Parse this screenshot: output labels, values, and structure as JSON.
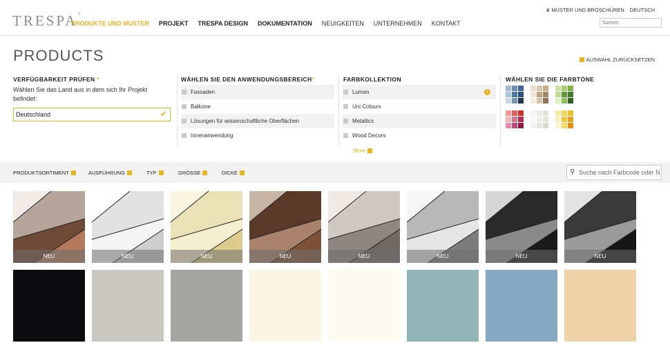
{
  "header": {
    "logo": "TRESPA",
    "nav": [
      "PRODUKTE UND MUSTER",
      "PROJEKT",
      "TRESPA DESIGN",
      "DOKUMENTATION",
      "NEUIGKEITEN",
      "UNTERNEHMEN",
      "KONTAKT"
    ],
    "utility": {
      "samples": "MUSTER UND BROSCHÜREN",
      "language": "DEUTSCH"
    },
    "search_placeholder": "Suchen"
  },
  "page": {
    "title": "PRODUCTS",
    "reset": "AUSWAHL ZURÜCKSETZEN"
  },
  "filters": {
    "availability": {
      "heading": "VERFÜGBARKEIT PRÜFEN",
      "required_mark": "*",
      "description": "Wählen Sie das Land aus in dem sich Ihr Projekt befindet:",
      "country": "Deutschland"
    },
    "application": {
      "heading": "WÄHLEN SIE DEN ANWENDUNGSBEREICH",
      "required_mark": "*",
      "options": [
        "Fassaden",
        "Balkone",
        "Lösungen für wissenschaftliche Oberflächen",
        "Innenanwendung"
      ]
    },
    "collection": {
      "heading": "FARBKOLLEKTION",
      "options": [
        "Lumen",
        "Uni Colours",
        "Metallics",
        "Wood Decors"
      ],
      "more": "More"
    },
    "tones": {
      "heading": "WÄHLEN SIE DIE FARBTÖNE",
      "groups": [
        [
          "#9fb7cf",
          "#6f8fb8",
          "#3f6796",
          "#a9c4dc",
          "#4d79a8",
          "#2d4f7b",
          "#cbd8e6",
          "#7894b5",
          "#1f3450"
        ],
        [
          "#e8dccb",
          "#d8c6ad",
          "#c7ae8c",
          "#efe5d6",
          "#bfa27e",
          "#a88964",
          "#f3ece1",
          "#d6c2a6",
          "#8d7458"
        ],
        [
          "#cfe3a6",
          "#a9cc6e",
          "#7fb34a",
          "#bcd98e",
          "#5a9a35",
          "#3f7d2a",
          "#e0eec5",
          "#8fc05a",
          "#2f6321"
        ],
        [
          "#f09a9a",
          "#e0605e",
          "#c8322f",
          "#f2b5b8",
          "#d9708a",
          "#b3304f",
          "#e28aa8",
          "#c04a72",
          "#8c1d3b"
        ],
        [
          "#f6f4ef",
          "#ecebe5",
          "#e3e1d9",
          "#f9f8f5",
          "#efede7",
          "#e6e4dc",
          "#f3f2ee",
          "#e8e6df",
          "#dcdad2"
        ],
        [
          "#f7e8a2",
          "#f2d65c",
          "#e9c02a",
          "#f9eebb",
          "#f0ca3b",
          "#e6a21c",
          "#fbf3cf",
          "#f4db6e",
          "#e08f17"
        ]
      ]
    }
  },
  "filter_bar": {
    "items": [
      "PRODUKTSORTIMENT",
      "AUSFÜHRUNG",
      "TYP",
      "GRÖSSE",
      "DICKE"
    ],
    "search_placeholder": "Suche nach Farbcode oder N"
  },
  "products": {
    "new_label": "NEU",
    "row1_palettes": [
      [
        "#b6a59a",
        "#6e4a37",
        "#b37a5d",
        "#f1ece8"
      ],
      [
        "#e2e2e2",
        "#f4f4f4",
        "#cfcfcf",
        "#ffffff"
      ],
      [
        "#ebe1b7",
        "#f5efcf",
        "#dccd8f",
        "#faf6e2"
      ],
      [
        "#5b3a2a",
        "#a8826a",
        "#7d5139",
        "#c8b5a6"
      ],
      [
        "#cfc9c3",
        "#8e8680",
        "#6f6964",
        "#efeae6"
      ],
      [
        "#b9b9b9",
        "#e5e5e5",
        "#7d7d7d",
        "#f6f6f6"
      ],
      [
        "#2a2a2a",
        "#8a8a8a",
        "#1a1a1a",
        "#d7d7d7"
      ],
      [
        "#3a3a3a",
        "#9a9a9a",
        "#151515",
        "#e4e4e4"
      ]
    ],
    "row2_colors": [
      "#0c0c0e",
      "#c8c7c1",
      "#a3a4a1",
      "#fbf6e4",
      "#fdfbf0",
      "#92b6b8",
      "#86a8c2",
      "#efd3a6"
    ]
  }
}
